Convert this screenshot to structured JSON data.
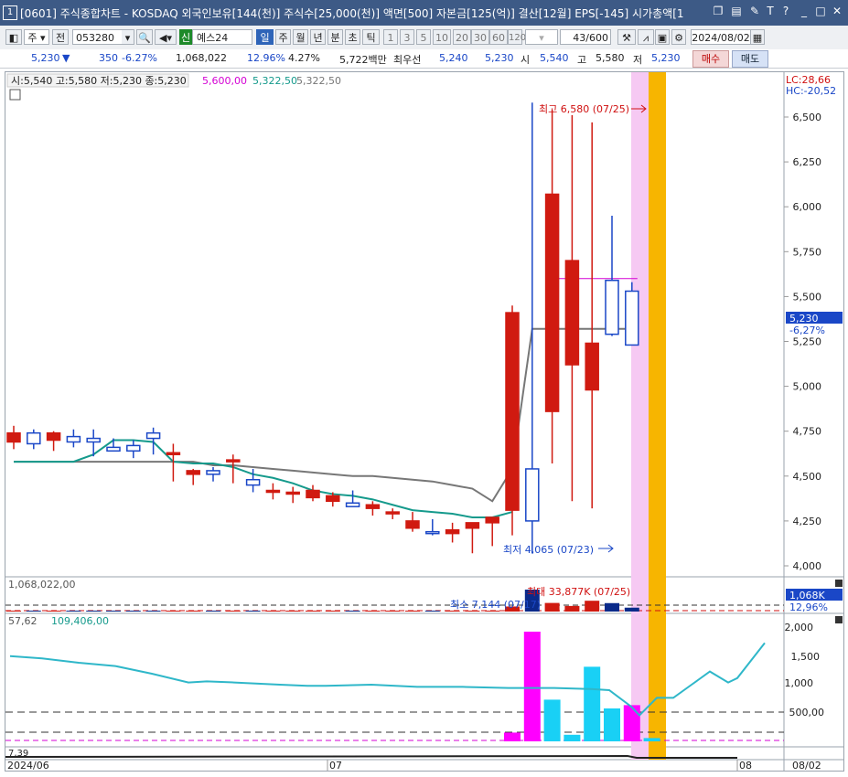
{
  "window": {
    "index": "1",
    "title": "[0601] 주식종합차트 - KOSDAQ 외국인보유[144(천)] 주식수[25,000(천)] 액면[500] 자본금[125(억)] 결산[12월] EPS[-145] 시가총액[1"
  },
  "toolbar": {
    "market": "주",
    "prev_label": "전",
    "stock_code": "053280",
    "stock_name": "예스24",
    "credit_badge": "신",
    "periods": [
      "일",
      "주",
      "월",
      "년",
      "분",
      "초",
      "틱"
    ],
    "selected_period": "일",
    "intervals": [
      "1",
      "3",
      "5",
      "10",
      "20",
      "30",
      "60",
      "120"
    ],
    "page_counter": "43/600",
    "date": "2024/08/02"
  },
  "quote": {
    "price": "5,230",
    "change": "350",
    "change_pct": "-6.27%",
    "volume": "1,068,022",
    "turnover_pct": "12.96%",
    "pct2": "4.27%",
    "amount": "5,722백만",
    "best_ask_label": "최우선",
    "best_ask_1": "5,240",
    "best_ask_2": "5,230",
    "open_label": "시",
    "open": "5,540",
    "high_label": "고",
    "high": "5,580",
    "low_label": "저",
    "low": "5,230",
    "buy_label": "매수",
    "sell_label": "매도"
  },
  "price_panel": {
    "ohlc_label": "시:5,540 고:5,580 저:5,230 종:5,230",
    "ma1_value": "5,600,00",
    "ma2_value": "5,322,50",
    "ma3_value": "5,322,50",
    "lc_label": "LC:28,66",
    "hc_label": "HC:-20,52",
    "y_ticks": [
      "6,500",
      "6,250",
      "6,000",
      "5,750",
      "5,500",
      "5,250",
      "5,000",
      "4,750",
      "4,500",
      "4,250",
      "4,000"
    ],
    "current_price_tag": "5,230",
    "current_pct_tag": "-6,27%",
    "high_annotation": "최고 6,580 (07/25)",
    "low_annotation": "최저 4,065 (07/23)"
  },
  "volume_panel": {
    "volume_label": "1,068,022,00",
    "max_annotation": "최대 33,877K (07/25)",
    "min_annotation": "최소 7,144 (07/17)",
    "vol_tag": "1,068K",
    "turnover_tag": "12,96%"
  },
  "indicator_panel": {
    "val1": "57,62",
    "val2": "109,406,00",
    "y_ticks": [
      "2,000",
      "1,500",
      "1,000",
      "500,00"
    ]
  },
  "bottom_panel": {
    "val": "7,39"
  },
  "x_axis": {
    "labels": [
      "2024/06",
      "07",
      "08",
      "08/02"
    ]
  },
  "chart_data": {
    "type": "candlestick",
    "x": [
      "06/20",
      "06/21",
      "06/24",
      "06/25",
      "06/26",
      "06/27",
      "06/28",
      "07/01",
      "07/02",
      "07/03",
      "07/04",
      "07/05",
      "07/08",
      "07/09",
      "07/10",
      "07/11",
      "07/12",
      "07/15",
      "07/16",
      "07/17",
      "07/18",
      "07/19",
      "07/22",
      "07/23",
      "07/24",
      "07/25",
      "07/26",
      "07/29",
      "07/30",
      "07/31",
      "08/01",
      "08/02"
    ],
    "open": [
      4690,
      4740,
      4700,
      4720,
      4710,
      4660,
      4670,
      4740,
      4620,
      4510,
      4530,
      4580,
      4480,
      4420,
      4400,
      4380,
      4360,
      4350,
      4320,
      4300,
      4210,
      4190,
      4180,
      4210,
      4240,
      4310,
      4540,
      4860,
      5120,
      4980,
      5590,
      5530
    ],
    "high": [
      4780,
      4760,
      4750,
      4760,
      4760,
      4710,
      4700,
      4770,
      4680,
      4540,
      4550,
      4620,
      4540,
      4460,
      4440,
      4450,
      4410,
      4420,
      4360,
      4320,
      4300,
      4260,
      4240,
      4230,
      4270,
      5450,
      6580,
      6540,
      6510,
      6470,
      5950,
      5580
    ],
    "low": [
      4650,
      4650,
      4640,
      4660,
      4610,
      4640,
      4600,
      4620,
      4470,
      4450,
      4470,
      4460,
      4410,
      4370,
      4350,
      4360,
      4330,
      4340,
      4280,
      4260,
      4190,
      4170,
      4130,
      4070,
      4110,
      4170,
      4070,
      4570,
      4360,
      4320,
      5280,
      5230
    ],
    "close": [
      4740,
      4680,
      4740,
      4690,
      4690,
      4640,
      4640,
      4710,
      4630,
      4530,
      4510,
      4590,
      4450,
      4420,
      4410,
      4420,
      4390,
      4330,
      4340,
      4300,
      4250,
      4180,
      4200,
      4240,
      4270,
      5410,
      4250,
      6070,
      5700,
      5240,
      5290,
      5230
    ],
    "ma_short": [
      4580,
      4580,
      4580,
      4580,
      4620,
      4700,
      4700,
      4690,
      4580,
      4570,
      4570,
      4550,
      4510,
      4490,
      4460,
      4420,
      4400,
      4390,
      4370,
      4340,
      4310,
      4300,
      4290,
      4270,
      4270,
      4300,
      4500,
      4860,
      5620,
      5320,
      5320,
      5320
    ],
    "ma_long": [
      4580,
      4580,
      4580,
      4580,
      4580,
      4580,
      4580,
      4580,
      4580,
      4580,
      4560,
      4560,
      4550,
      4540,
      4530,
      4520,
      4510,
      4500,
      4500,
      4490,
      4480,
      4470,
      4450,
      4430,
      4360,
      4540,
      5320,
      5320,
      5320,
      5320,
      5320,
      5320
    ],
    "ylim": [
      3950,
      6620
    ],
    "volume_k": [
      40,
      30,
      35,
      40,
      30,
      25,
      20,
      45,
      40,
      20,
      22,
      26,
      28,
      18,
      12,
      15,
      14,
      10,
      9,
      7,
      12,
      15,
      18,
      25,
      40,
      1800,
      33877,
      5200,
      2200,
      8200,
      5000,
      1068
    ]
  }
}
